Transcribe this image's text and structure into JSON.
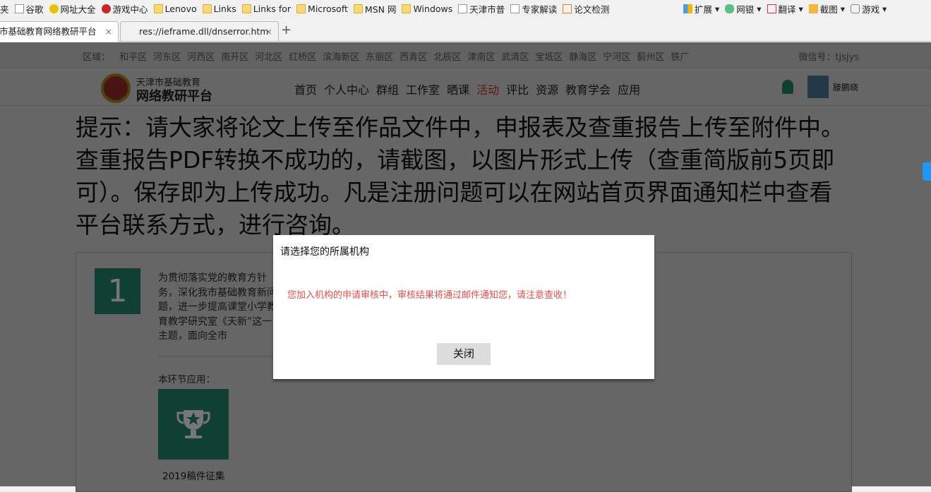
{
  "bookmarks": [
    "夹",
    "谷歌",
    "网址大全",
    "游戏中心",
    "Lenovo",
    "Links",
    "Links for",
    "Microsoft",
    "MSN 网",
    "Windows",
    "天津市普",
    "专家解读",
    "论文检测"
  ],
  "toolbar": [
    "扩展",
    "网银",
    "翻译",
    "截图",
    "游戏"
  ],
  "tabs": [
    {
      "label": "市基础教育网络教研平台"
    },
    {
      "label": "res://ieframe.dll/dnserror.htm"
    }
  ],
  "new_tab": "+",
  "close": "×",
  "region": {
    "label": "区域：",
    "items": [
      "和平区",
      "河东区",
      "河西区",
      "南开区",
      "河北区",
      "红桥区",
      "滨海新区",
      "东丽区",
      "西青区",
      "北辰区",
      "津南区",
      "武清区",
      "宝坻区",
      "静海区",
      "宁河区",
      "蓟州区",
      "铁厂"
    ],
    "wechat": "微信号：tjsjys"
  },
  "logo": {
    "line1": "天津市基础教育",
    "line2": "网络教研平台"
  },
  "menu": [
    "首页",
    "个人中心",
    "群组",
    "工作室",
    "晒课",
    "活动",
    "评比",
    "资源",
    "教育学会",
    "应用"
  ],
  "user": "滕鹏晓",
  "notice": "提示：请大家将论文上传至作品文件中，申报表及查重报告上传至附件中。查重报告PDF转换不成功的，请截图，以图片形式上传（查重简版前5页即可）。保存即为上传成功。凡是注册问题可以在网站首页界面通知栏中查看平台联系方式，进行咨询。",
  "card": {
    "number": "1",
    "desc": "为贯彻落实党的教育方针务，深化我市基础教育新问题，进一步提高课堂小学教育教学研究室《天新”这一主题，面向全市",
    "apps_label": "本环节应用：",
    "app": "2019稿件征集"
  },
  "dialog": {
    "title": "请选择您的所属机构",
    "message": "您加入机构的申请审核中，审核结果将通过邮件通知您，请注意查收！",
    "close": "关闭"
  }
}
